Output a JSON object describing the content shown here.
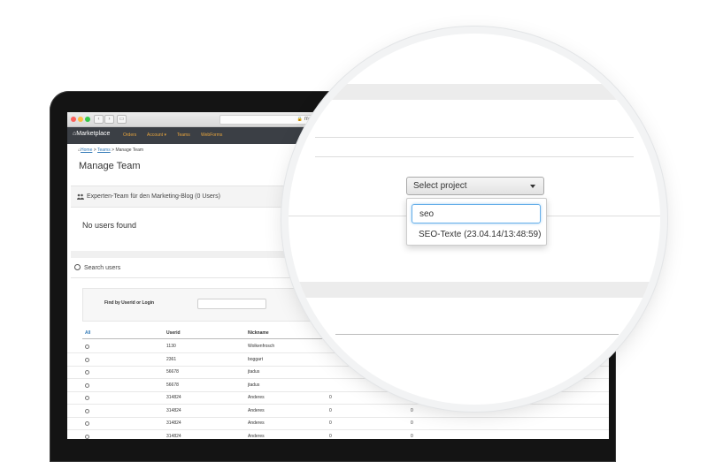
{
  "browser": {
    "url": "market"
  },
  "navbar": {
    "brand": "Marketplace",
    "links": [
      "Orders",
      "Account ▾",
      "Teams",
      "WebForms"
    ]
  },
  "breadcrumb": {
    "home": "Home",
    "teams": "Teams",
    "current": "Manage Team",
    "sep": ">"
  },
  "page_title": "Manage Team",
  "team_panel": {
    "title": "Experten-Team für den Marketing-Blog (0 Users)",
    "empty": "No users found"
  },
  "search": {
    "title": "Search users",
    "find_label": "Find by Userid or Login",
    "find_value": ""
  },
  "table": {
    "columns": [
      "All",
      "Userid",
      "Nickname"
    ],
    "rows": [
      {
        "userid": "1130",
        "nickname": "Wolkenfrosch",
        "c3": "",
        "c4": ""
      },
      {
        "userid": "2361",
        "nickname": "boggart",
        "c3": "",
        "c4": ""
      },
      {
        "userid": "56678",
        "nickname": "jtadus",
        "c3": "",
        "c4": ""
      },
      {
        "userid": "56678",
        "nickname": "jtadus",
        "c3": "",
        "c4": ""
      },
      {
        "userid": "314824",
        "nickname": "Anderes",
        "c3": "0",
        "c4": ""
      },
      {
        "userid": "314824",
        "nickname": "Anderes",
        "c3": "0",
        "c4": "0"
      },
      {
        "userid": "314824",
        "nickname": "Anderes",
        "c3": "0",
        "c4": "0"
      },
      {
        "userid": "314824",
        "nickname": "Anderes",
        "c3": "0",
        "c4": "0"
      }
    ]
  },
  "project_select": {
    "button_label": "Select project",
    "search_value": "seo",
    "options": [
      "SEO-Texte (23.04.14/13:48:59)"
    ]
  },
  "colors": {
    "navbar_bg": "#3b3f45",
    "nav_link": "#e8a53d",
    "link": "#337ab7",
    "focus": "#66afe9"
  }
}
